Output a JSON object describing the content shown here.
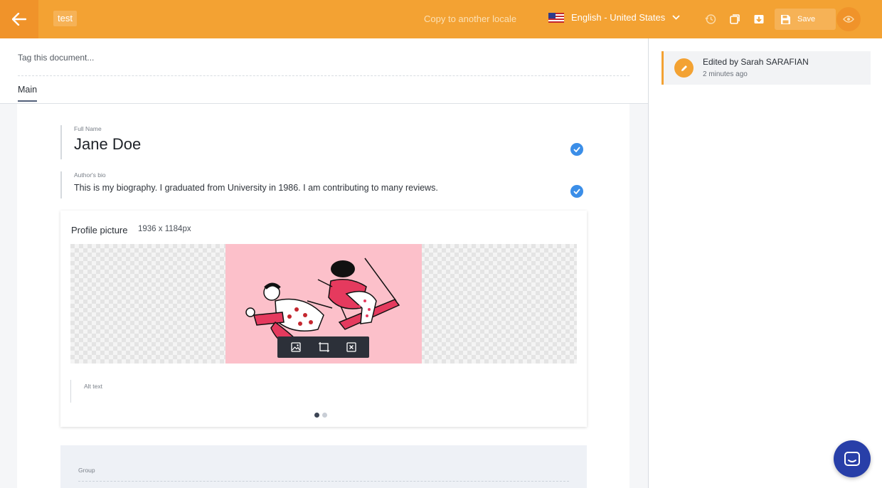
{
  "topbar": {
    "document_name": "test",
    "copy_locale_label": "Copy to another locale",
    "locale_label": "English - United States",
    "save_label": "Save",
    "accent_color": "#f3a233"
  },
  "tags": {
    "placeholder": "Tag this document..."
  },
  "tabs": [
    {
      "label": "Main",
      "active": true
    }
  ],
  "fields": {
    "full_name": {
      "label": "Full Name",
      "value": "Jane Doe"
    },
    "bio": {
      "label": "Author's bio",
      "value": "This is my biography. I graduated from University in 1986. I am contributing to many reviews."
    }
  },
  "profile_picture": {
    "title": "Profile picture",
    "dimensions": "1936 x 1184px",
    "alt_label": "Alt text",
    "dots": 2,
    "active_dot": 0
  },
  "group": {
    "label": "Group"
  },
  "activity": {
    "title": "Edited by Sarah SARAFIAN",
    "time": "2 minutes ago"
  },
  "icons": {
    "back": "arrow-left-icon",
    "locale_flag": "us-flag-icon",
    "history": "history-icon",
    "duplicate": "copy-icon",
    "archive": "archive-icon",
    "save": "floppy-disk-icon",
    "preview": "eye-icon",
    "check": "check-circle-icon",
    "edit": "pencil-icon",
    "chat": "chat-icon"
  }
}
